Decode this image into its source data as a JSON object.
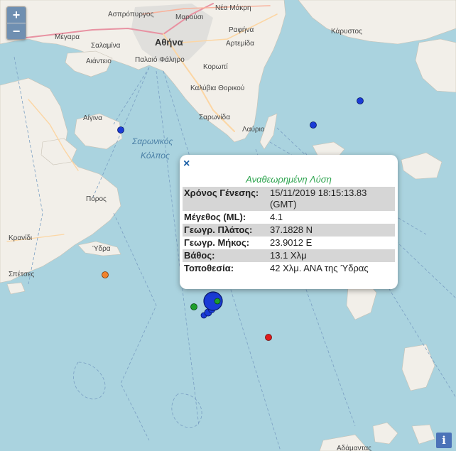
{
  "map": {
    "zoom_in": "+",
    "zoom_out": "−",
    "info": "i",
    "sea_label_line1": "Σαρωνικός",
    "sea_label_line2": "Κόλπος",
    "places": [
      {
        "name": "Ασπρόπυργος"
      },
      {
        "name": "Μαρούσι"
      },
      {
        "name": "Νέα Μάκρη"
      },
      {
        "name": "Αθήνα"
      },
      {
        "name": "Μέγαρα"
      },
      {
        "name": "Σαλαμίνα"
      },
      {
        "name": "Παλαιό Φάληρο"
      },
      {
        "name": "Ραφήνα"
      },
      {
        "name": "Αρτεμίδα"
      },
      {
        "name": "Κάρυστος"
      },
      {
        "name": "Αιάντειο"
      },
      {
        "name": "Κορωπί"
      },
      {
        "name": "Καλύβια Θορικού"
      },
      {
        "name": "Αίγινα"
      },
      {
        "name": "Σαρωνίδα"
      },
      {
        "name": "Λαύριο"
      },
      {
        "name": "Πόρος"
      },
      {
        "name": "Κρανίδι"
      },
      {
        "name": "Ύδρα"
      },
      {
        "name": "Σπέτσες"
      },
      {
        "name": "Αδάμαντας"
      }
    ],
    "quake_colors": {
      "blue": "#1a3bd6",
      "green": "#1e9e2c",
      "orange": "#f0822c",
      "red": "#e01b1b"
    }
  },
  "popup": {
    "close": "×",
    "title": "Αναθεωρημένη Λύση",
    "rows": [
      {
        "label": "Χρόνος Γένεσης:",
        "value": "15/11/2019 18:15:13.83 (GMT)"
      },
      {
        "label": "Μέγεθος (ML):",
        "value": "4.1"
      },
      {
        "label": "Γεωγρ. Πλάτος:",
        "value": "37.1828 N"
      },
      {
        "label": "Γεωγρ. Μήκος:",
        "value": "23.9012 E"
      },
      {
        "label": "Βάθος:",
        "value": "13.1 Χλμ"
      },
      {
        "label": "Τοποθεσία:",
        "value": "42 Χλμ. ΑΝΑ της Ύδρας"
      }
    ]
  }
}
